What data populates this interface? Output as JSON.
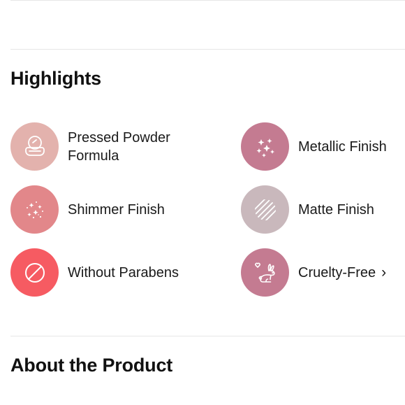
{
  "highlights": {
    "title": "Highlights",
    "items": [
      {
        "label": "Pressed Powder\nFormula",
        "icon": "compact-powder-icon",
        "color": "#e3b2ad"
      },
      {
        "label": "Metallic Finish",
        "icon": "sparkles-icon",
        "color": "#c47b91"
      },
      {
        "label": "Shimmer Finish",
        "icon": "shimmer-sparkles-icon",
        "color": "#e2878a"
      },
      {
        "label": "Matte Finish",
        "icon": "matte-stripes-icon",
        "color": "#c9b8bc"
      },
      {
        "label": "Without Parabens",
        "icon": "prohibited-icon",
        "color": "#f65b62"
      },
      {
        "label": "Cruelty-Free",
        "icon": "bunny-heart-icon",
        "color": "#c47b91"
      }
    ]
  },
  "about": {
    "title": "About the Product"
  }
}
